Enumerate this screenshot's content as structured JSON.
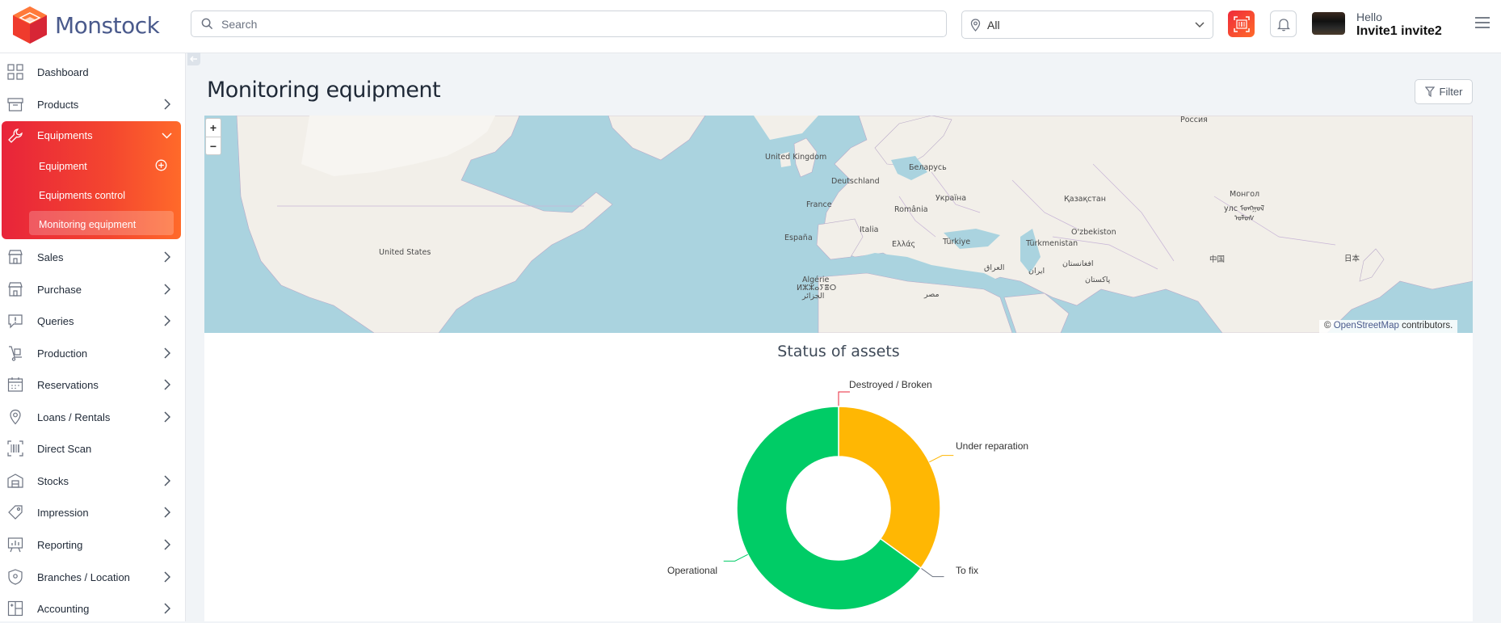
{
  "app": {
    "name": "Monstock"
  },
  "header": {
    "search_placeholder": "Search",
    "location_value": "All",
    "greeting": "Hello",
    "username": "Invite1 invite2"
  },
  "sidebar": {
    "items": [
      {
        "label": "Dashboard",
        "icon": "grid-icon",
        "arrow": false
      },
      {
        "label": "Products",
        "icon": "box-icon",
        "arrow": true
      },
      {
        "label": "Equipments",
        "icon": "wrench-icon",
        "arrow": true,
        "expanded": true
      },
      {
        "label": "Sales",
        "icon": "store-icon",
        "arrow": true
      },
      {
        "label": "Purchase",
        "icon": "store-icon",
        "arrow": true
      },
      {
        "label": "Queries",
        "icon": "alert-bubble-icon",
        "arrow": true
      },
      {
        "label": "Production",
        "icon": "hand-truck-icon",
        "arrow": true
      },
      {
        "label": "Reservations",
        "icon": "calendar-icon",
        "arrow": true
      },
      {
        "label": "Loans / Rentals",
        "icon": "pin-icon",
        "arrow": true
      },
      {
        "label": "Direct Scan",
        "icon": "scan-icon",
        "arrow": false
      },
      {
        "label": "Stocks",
        "icon": "warehouse-icon",
        "arrow": true
      },
      {
        "label": "Impression",
        "icon": "tag-icon",
        "arrow": true
      },
      {
        "label": "Reporting",
        "icon": "chart-board-icon",
        "arrow": true
      },
      {
        "label": "Branches / Location",
        "icon": "location-shield-icon",
        "arrow": true
      },
      {
        "label": "Accounting",
        "icon": "ledger-icon",
        "arrow": true
      }
    ],
    "equipment_sub": [
      {
        "label": "Equipment"
      },
      {
        "label": "Equipments control"
      },
      {
        "label": "Monitoring equipment",
        "active": true
      }
    ]
  },
  "main": {
    "title": "Monitoring equipment",
    "filter_label": "Filter",
    "map": {
      "zoom_in": "+",
      "zoom_out": "−",
      "attribution_symbol": "©",
      "attribution_link": "OpenStreetMap",
      "attribution_suffix": "contributors.",
      "labels": [
        "Россия",
        "United Kingdom",
        "Беларусь",
        "Deutschland",
        "Україна",
        "France",
        "România",
        "Қазақстан",
        "Монгол",
        "улс ᠮᠤᠩᠭᠣᠯ",
        "ᠤᠯᠤᠰ",
        "España",
        "Italia",
        "O'zbekiston",
        "Türkiye",
        "Türkmenistan",
        "Ελλάς",
        "United States",
        "中国",
        "日本",
        "العراق",
        "ایران",
        "افغانستان",
        "Algérie",
        "ⵍⵣⵣⴰⵢⴻⵔ",
        "الجزائر",
        "پاکستان",
        "مصر"
      ]
    }
  },
  "chart_data": {
    "type": "pie",
    "title": "Status of assets",
    "donut": true,
    "series": [
      {
        "name": "Destroyed / Broken",
        "value": 0,
        "color": "#e8243a"
      },
      {
        "name": "Under reparation",
        "value": 35,
        "color": "#ffb703"
      },
      {
        "name": "To fix",
        "value": 0,
        "color": "#6b7280"
      },
      {
        "name": "Operational",
        "value": 65,
        "color": "#00cc66"
      }
    ]
  }
}
